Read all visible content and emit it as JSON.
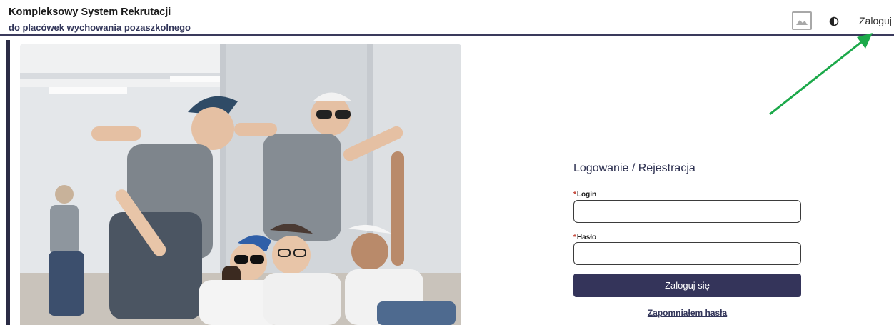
{
  "header": {
    "title": "Kompleksowy System Rekrutacji",
    "subtitle": "do placówek wychowania pozaszkolnego",
    "login_link": "Zaloguj",
    "image_toggle_icon": "image-icon",
    "contrast_icon": "contrast-icon"
  },
  "hero_image": {
    "icon": "photo-dancing-teens"
  },
  "annotation": {
    "icon": "green-arrow-icon",
    "color": "#1ca94a"
  },
  "form": {
    "title": "Logowanie / Rejestracja",
    "required_marker": "*",
    "login_label": "Login",
    "login_value": "",
    "password_label": "Hasło",
    "password_value": "",
    "submit_label": "Zaloguj się",
    "forgot_link": "Zapomniałem hasła"
  },
  "colors": {
    "accent": "#34345a",
    "header_border": "#3a3a5c",
    "required": "#c0392b"
  }
}
